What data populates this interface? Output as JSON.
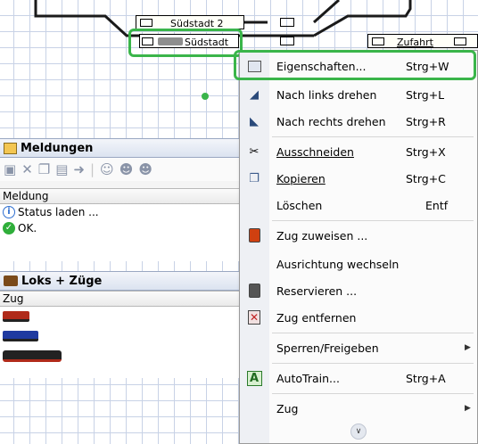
{
  "colors": {
    "highlight": "#3ab54a",
    "grid": "#c8d2e6",
    "panel_title_bg": "#dbe3f0"
  },
  "canvas": {
    "blocks": [
      {
        "id": "suedstadt2",
        "label": "Südstadt 2"
      },
      {
        "id": "suedstadt",
        "label": "Südstadt"
      },
      {
        "id": "zufahrt",
        "label": "Zufahrt"
      }
    ]
  },
  "messages_panel": {
    "title": "Meldungen",
    "icon": "messages-icon",
    "toolbar": [
      "save-icon",
      "delete-icon",
      "copy-icon",
      "properties-icon",
      "forward-icon",
      "person-icon",
      "group-icon",
      "group-icon",
      "group-icon"
    ],
    "column": "Meldung",
    "rows": [
      {
        "icon": "info-icon",
        "text": "Status laden ..."
      },
      {
        "icon": "ok-check-icon",
        "text": "OK."
      }
    ]
  },
  "trains_panel": {
    "title": "Loks + Züge",
    "icon": "train-icon",
    "column": "Zug",
    "rows": [
      {
        "icon": "red-locomotive-icon"
      },
      {
        "icon": "blue-locomotive-icon"
      },
      {
        "icon": "steam-locomotive-icon"
      }
    ]
  },
  "context_menu": {
    "items": [
      {
        "icon": "properties-icon",
        "label": "Eigenschaften...",
        "shortcut": "Strg+W",
        "highlighted": true
      },
      {
        "icon": "rotate-left-icon",
        "label": "Nach links drehen",
        "shortcut": "Strg+L"
      },
      {
        "icon": "rotate-right-icon",
        "label": "Nach rechts drehen",
        "shortcut": "Strg+R"
      },
      {
        "icon": "scissors-icon",
        "label": "Ausschneiden",
        "shortcut": "Strg+X"
      },
      {
        "icon": "copy-icon",
        "label": "Kopieren",
        "shortcut": "Strg+C"
      },
      {
        "icon": "",
        "label": "Löschen",
        "shortcut": "Entf"
      },
      {
        "icon": "signal-icon",
        "label": "Zug zuweisen ...",
        "shortcut": ""
      },
      {
        "icon": "",
        "label": "Ausrichtung wechseln",
        "shortcut": ""
      },
      {
        "icon": "signal-dark-icon",
        "label": "Reservieren ...",
        "shortcut": ""
      },
      {
        "icon": "remove-train-icon",
        "label": "Zug entfernen",
        "shortcut": ""
      },
      {
        "icon": "",
        "label": "Sperren/Freigeben",
        "shortcut": "",
        "submenu": true
      },
      {
        "icon": "autotrain-icon",
        "label": "AutoTrain...",
        "shortcut": "Strg+A"
      },
      {
        "icon": "",
        "label": "Zug",
        "shortcut": "",
        "submenu": true
      }
    ],
    "expand_icon": "expand-more-icon"
  }
}
